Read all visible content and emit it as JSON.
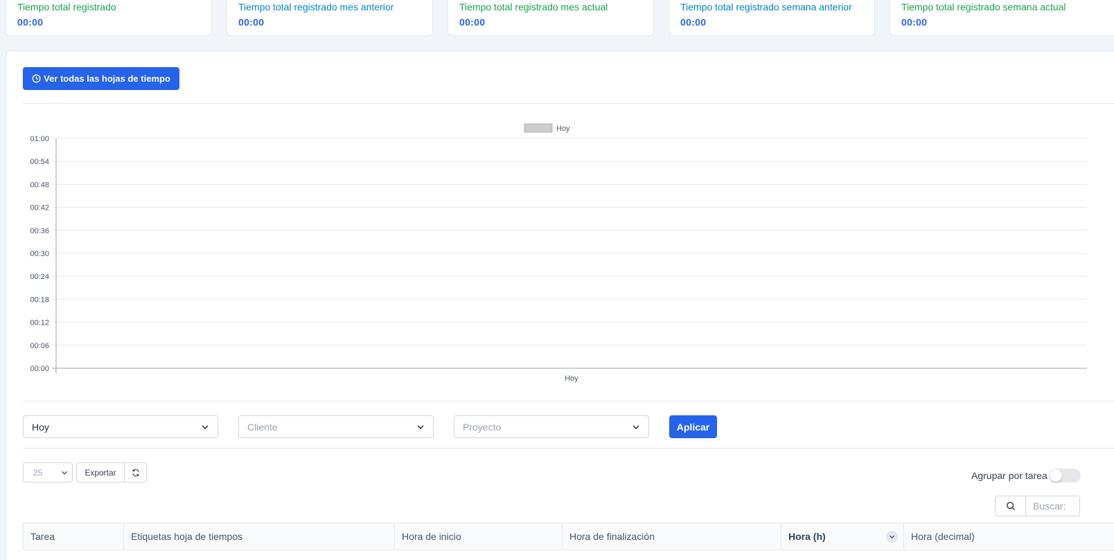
{
  "stats": [
    {
      "label": "Tiempo total registrado",
      "value": "00:00",
      "color": "#16a34a"
    },
    {
      "label": "Tiempo total registrado mes anterior",
      "value": "00:00",
      "color": "#0284c7"
    },
    {
      "label": "Tiempo total registrado mes actual",
      "value": "00:00",
      "color": "#16a34a"
    },
    {
      "label": "Tiempo total registrado semana anterior",
      "value": "00:00",
      "color": "#0284c7"
    },
    {
      "label": "Tiempo total registrado semana actual",
      "value": "00:00",
      "color": "#16a34a"
    }
  ],
  "view_all_button": {
    "label": "Ver todas las hojas de tiempo",
    "icon": "clock-icon"
  },
  "chart_data": {
    "type": "bar",
    "categories": [
      "Hoy"
    ],
    "series": [
      {
        "name": "Hoy",
        "values": [
          0
        ],
        "color": "#cccccc"
      }
    ],
    "ylim": [
      "00:00",
      "01:00"
    ],
    "yticks": [
      "01:00",
      "00:54",
      "00:48",
      "00:42",
      "00:36",
      "00:30",
      "00:24",
      "00:18",
      "00:12",
      "00:06",
      "00:00"
    ],
    "legend_position": "top-center",
    "grid": true
  },
  "filters": {
    "period": {
      "value": "Hoy"
    },
    "client": {
      "placeholder": "Cliente"
    },
    "project": {
      "placeholder": "Proyecto"
    },
    "apply_label": "Aplicar"
  },
  "table_controls": {
    "page_length": "25",
    "export_label": "Exportar",
    "refresh_icon": "refresh-icon",
    "group_by_task_label": "Agrupar por tarea",
    "group_by_task_on": false,
    "search_placeholder": "Buscar:"
  },
  "table": {
    "columns": [
      "Tarea",
      "Etiquetas hoja de tiempos",
      "Hora de inicio",
      "Hora de finalización",
      "Hora (h)",
      "Hora (decimal)"
    ],
    "sorted_column": "Hora (h)"
  },
  "colors": {
    "accent": "#2563eb",
    "green": "#16a34a",
    "blue": "#0284c7"
  }
}
